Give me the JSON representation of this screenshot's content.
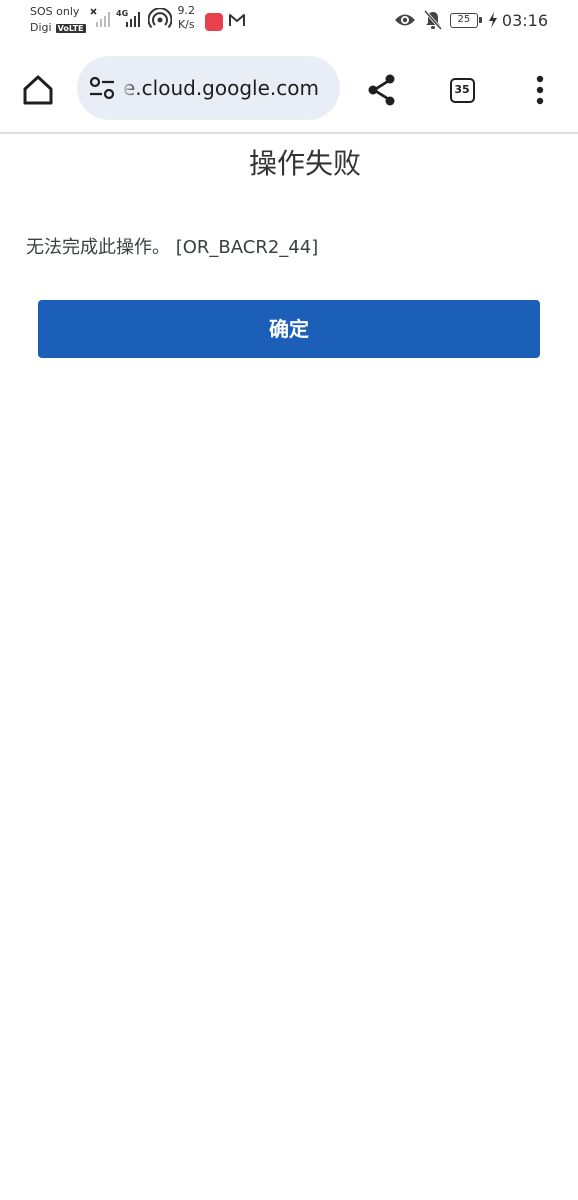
{
  "status_bar": {
    "carrier_line1": "SOS only",
    "carrier_line2": "Digi",
    "volte_badge": "VoLTE",
    "network_type": "4G",
    "speed_value": "9.2",
    "speed_unit": "K/s",
    "battery_level": "25",
    "time": "03:16",
    "icons": [
      "signal-x-icon",
      "signal-4g-icon",
      "hotspot-icon",
      "app-notification-icon",
      "mail-icon",
      "eye-icon",
      "bell-off-icon",
      "battery-icon",
      "charging-icon"
    ]
  },
  "browser": {
    "url": "e.cloud.google.com",
    "tab_count": "35",
    "icons": [
      "home-icon",
      "tune-icon",
      "share-icon",
      "tab-switcher-icon",
      "more-vert-icon"
    ]
  },
  "dialog": {
    "title": "操作失败",
    "message": "无法完成此操作。 [OR_BACR2_44]",
    "ok_label": "确定"
  },
  "colors": {
    "primary_button": "#1b5fb8",
    "omnibox_bg": "#e9edf6",
    "text_dark": "#333333",
    "app_badge": "#e8414b"
  }
}
